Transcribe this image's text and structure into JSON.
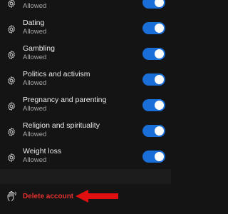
{
  "colors": {
    "background": "#141414",
    "toggle_on": "#1a6ed8",
    "delete_red": "#e53030",
    "annotation_arrow": "#e01010"
  },
  "icons": {
    "row_icon": "gear-icon",
    "delete_icon": "hand-wave-icon",
    "annotation": "arrow-left-icon"
  },
  "settings": [
    {
      "title": "",
      "subtitle": "Allowed",
      "enabled": true
    },
    {
      "title": "Dating",
      "subtitle": "Allowed",
      "enabled": true
    },
    {
      "title": "Gambling",
      "subtitle": "Allowed",
      "enabled": true
    },
    {
      "title": "Politics and activism",
      "subtitle": "Allowed",
      "enabled": true
    },
    {
      "title": "Pregnancy and parenting",
      "subtitle": "Allowed",
      "enabled": true
    },
    {
      "title": "Religion and spirituality",
      "subtitle": "Allowed",
      "enabled": true
    },
    {
      "title": "Weight loss",
      "subtitle": "Allowed",
      "enabled": true
    }
  ],
  "account": {
    "delete_label": "Delete account"
  }
}
